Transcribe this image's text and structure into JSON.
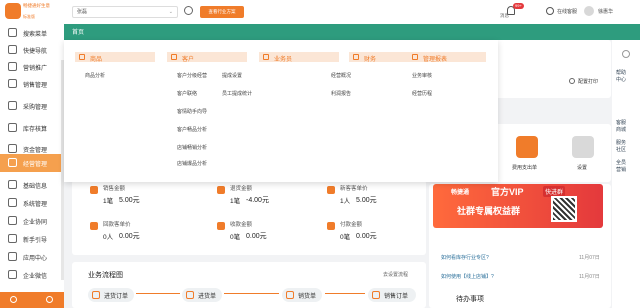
{
  "header": {
    "brand_name": "畅捷通好生意",
    "brand_sub": "标准版",
    "search_value": "张磊",
    "search_button": "查看行业方案",
    "notification_label": "消息",
    "notification_badge": "99+",
    "service_label": "在线客服",
    "user_name": "徐惠华"
  },
  "sidebar": {
    "items": [
      {
        "label": "搜索菜单"
      },
      {
        "label": "快捷导航"
      },
      {
        "label": "营销推广"
      },
      {
        "label": "销售管理"
      },
      {
        "label": "采购管理"
      },
      {
        "label": "库存核算"
      },
      {
        "label": "资金管理"
      },
      {
        "label": "经营管理"
      },
      {
        "label": "基础信息"
      },
      {
        "label": "系统管理"
      },
      {
        "label": "企业协同"
      },
      {
        "label": "新手引导"
      },
      {
        "label": "应用中心"
      },
      {
        "label": "企业微信"
      }
    ]
  },
  "tabs": {
    "home": "首页"
  },
  "mega_menu": {
    "columns": [
      {
        "title": "商品",
        "links": [
          "商品分析"
        ]
      },
      {
        "title": "客户",
        "links": [
          "客户分级经营",
          "客户联络",
          "客情助手向导",
          "客户畅品分析",
          "店铺畅销分析",
          "店铺爆品分析"
        ]
      },
      {
        "title": "业务员",
        "links": [
          "提成设置",
          "员工提成统计"
        ]
      },
      {
        "title": "财务",
        "links": [
          "经营概况",
          "利润报告"
        ]
      },
      {
        "title": "管理报表",
        "links": [
          "业务审核",
          "经营历程"
        ]
      }
    ]
  },
  "stats": [
    {
      "label": "销售金额",
      "count": "1笔",
      "amount": "5.00元"
    },
    {
      "label": "退货金额",
      "count": "1笔",
      "amount": "-4.00元"
    },
    {
      "label": "新客客单价",
      "count": "1人",
      "amount": "5.00元"
    },
    {
      "label": "回款客单价",
      "count": "0人",
      "amount": "0.00元"
    },
    {
      "label": "收款金额",
      "count": "0笔",
      "amount": "0.00元"
    },
    {
      "label": "付款金额",
      "count": "0笔",
      "amount": "0.00元"
    }
  ],
  "flow": {
    "title": "业务流程图",
    "settings_link": "去设置流程",
    "nodes": [
      "进货订单",
      "进货单",
      "销货单",
      "销售订单"
    ]
  },
  "right_panel": {
    "config_label": "配置打印",
    "quick": [
      "费用支出单",
      "设置"
    ],
    "banner": {
      "brand": "畅捷通",
      "headline_1": "官方VIP",
      "headline_2": "社群专属权益群",
      "tag": "快进群"
    },
    "notices": [
      {
        "text": "如何看库存行业专区?",
        "date": "11月07日"
      },
      {
        "text": "如何使用【线上店铺】?",
        "date": "11月07日"
      }
    ],
    "footer_label": "待办事项"
  },
  "far_right": [
    "帮助",
    "中心",
    "客服",
    "商城",
    "服务",
    "社区",
    "全员",
    "营销"
  ],
  "colors": {
    "accent": "#f07c2a",
    "tab_bar": "#2e9c7e",
    "active_item": "#f5a04e"
  }
}
